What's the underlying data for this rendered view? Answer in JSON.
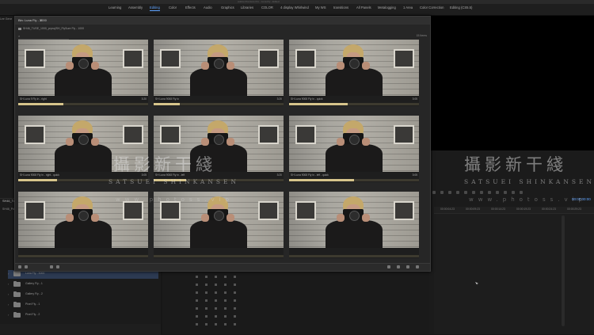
{
  "window": {
    "title": "Adobe Premiere Pro - Luna Fly - Edited"
  },
  "workspace_tabs": [
    "Learning",
    "Assembly",
    "Editing",
    "Color",
    "Effects",
    "Audio",
    "Graphics",
    "Libraries",
    "COLOR",
    "4 display Whirlwind",
    "My WS",
    "transitions",
    "All Panels",
    "Metalogging",
    "1 Area",
    "Color Correction",
    "Editing (CS5.5)"
  ],
  "active_workspace": "Editing",
  "left_panel": {
    "label": "Lee Gene"
  },
  "program": {
    "timecode": "00:00:00:00"
  },
  "timeline": {
    "ruler_ticks": [
      "00:00:04:23",
      "00:00:09:23",
      "00:00:14:23",
      "00:00:19:23",
      "00:00:24:23",
      "00:00:29:23"
    ]
  },
  "project": {
    "tab": "SH46_Tutorial",
    "path": "SH46_Pdf",
    "rows": [
      {
        "name": "Luna Fly - 3000",
        "selected": true
      },
      {
        "name": "Gallery Fly - 1",
        "selected": false
      },
      {
        "name": "Gallery Fly - 2",
        "selected": false
      },
      {
        "name": "Pixel Fly - 1",
        "selected": false
      },
      {
        "name": "Pixel Fly - 2",
        "selected": false
      }
    ]
  },
  "bin": {
    "title": "Bin: Luna Fly - 3000",
    "path": "SH46_TUSE_1000_prproj/SH_FlySure Fly - 1000",
    "count": "15 Items",
    "search_placeholder": "",
    "clips": [
      {
        "name": "SH Luna 9 Fly in - right",
        "duration": "3:20",
        "progress": 0.35
      },
      {
        "name": "SH Luna 9008 Fly in",
        "duration": "3:20",
        "progress": 0.2
      },
      {
        "name": "SH Luna 9008 Fly in - quick",
        "duration": "3:05",
        "progress": 0.45
      },
      {
        "name": "SH Luna 9008 Fly in - right - quick",
        "duration": "3:05",
        "progress": 0.3
      },
      {
        "name": "SH Luna 9008 Fly in - left",
        "duration": "3:20",
        "progress": 0.25
      },
      {
        "name": "SH Luna 9008 Fly in - left - quick",
        "duration": "3:05",
        "progress": 0.5
      },
      {
        "name": "",
        "duration": "",
        "progress": 0
      },
      {
        "name": "",
        "duration": "",
        "progress": 0
      },
      {
        "name": "",
        "duration": "",
        "progress": 0
      }
    ]
  },
  "watermark": {
    "cn": "攝影新干綫",
    "en": "SATSUEI SHINKANSEN",
    "web": "www.photoss.vip",
    "cn2": "攝影新干綫",
    "en2": "SATSUEI SHINKANSEN",
    "web2": "www.photoss.vip"
  }
}
